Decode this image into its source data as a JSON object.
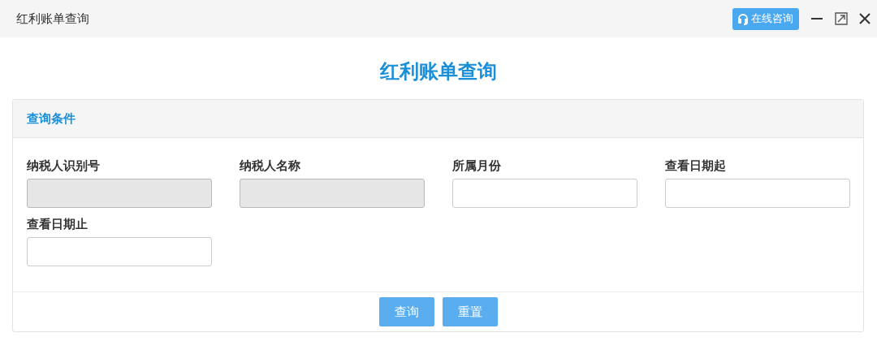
{
  "window": {
    "title": "红利账单查询",
    "consult_button": "在线咨询"
  },
  "heading": "红利账单查询",
  "panel": {
    "title": "查询条件",
    "fields": [
      {
        "label": "纳税人识别号",
        "disabled": true
      },
      {
        "label": "纳税人名称",
        "disabled": true
      },
      {
        "label": "所属月份",
        "disabled": false
      },
      {
        "label": "查看日期起",
        "disabled": false
      },
      {
        "label": "查看日期止",
        "disabled": false
      }
    ],
    "buttons": [
      "查询",
      "重置"
    ]
  }
}
